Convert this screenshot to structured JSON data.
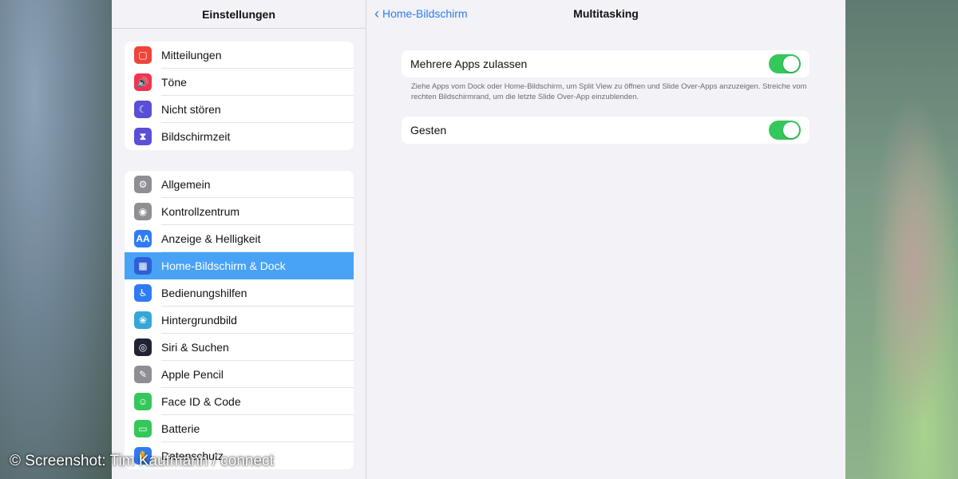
{
  "sidebar": {
    "title": "Einstellungen",
    "group1": [
      {
        "label": "Mitteilungen",
        "icon": "notifications-icon",
        "color": "#f0443a",
        "glyph": "▢"
      },
      {
        "label": "Töne",
        "icon": "sounds-icon",
        "color": "#f0344f",
        "glyph": "🔊"
      },
      {
        "label": "Nicht stören",
        "icon": "do-not-disturb-icon",
        "color": "#5a4fd6",
        "glyph": "☾"
      },
      {
        "label": "Bildschirmzeit",
        "icon": "screen-time-icon",
        "color": "#5a4fd6",
        "glyph": "⧗"
      }
    ],
    "group2": [
      {
        "label": "Allgemein",
        "icon": "general-icon",
        "color": "#8e8e93",
        "glyph": "⚙"
      },
      {
        "label": "Kontrollzentrum",
        "icon": "control-center-icon",
        "color": "#8e8e93",
        "glyph": "◉"
      },
      {
        "label": "Anzeige & Helligkeit",
        "icon": "display-icon",
        "color": "#2f7bf5",
        "glyph": "AA"
      },
      {
        "label": "Home-Bildschirm & Dock",
        "icon": "home-screen-icon",
        "color": "#2f5fd6",
        "glyph": "▦",
        "selected": true
      },
      {
        "label": "Bedienungshilfen",
        "icon": "accessibility-icon",
        "color": "#2f7bf5",
        "glyph": "♿"
      },
      {
        "label": "Hintergrundbild",
        "icon": "wallpaper-icon",
        "color": "#35a6d6",
        "glyph": "❀"
      },
      {
        "label": "Siri & Suchen",
        "icon": "siri-icon",
        "color": "#222236",
        "glyph": "◎"
      },
      {
        "label": "Apple Pencil",
        "icon": "pencil-icon",
        "color": "#8e8e93",
        "glyph": "✎"
      },
      {
        "label": "Face ID & Code",
        "icon": "face-id-icon",
        "color": "#34c759",
        "glyph": "☺"
      },
      {
        "label": "Batterie",
        "icon": "battery-icon",
        "color": "#34c759",
        "glyph": "▭"
      },
      {
        "label": "Datenschutz",
        "icon": "privacy-icon",
        "color": "#2f7bf5",
        "glyph": "✋"
      }
    ]
  },
  "detail": {
    "back_label": "Home-Bildschirm",
    "title": "Multitasking",
    "setting1": {
      "label": "Mehrere Apps zulassen",
      "on": true
    },
    "footnote": "Ziehe Apps vom Dock oder Home-Bildschirm, um Split View zu öffnen und Slide Over-Apps anzuzeigen. Streiche vom rechten Bildschirmrand, um die letzte Slide Over-App einzublenden.",
    "setting2": {
      "label": "Gesten",
      "on": true
    }
  },
  "watermark": "© Screenshot: Tim Kaufmann / connect",
  "colors": {
    "accent": "#2f7bf5",
    "selected": "#48a2f5",
    "toggle_on": "#34c759"
  }
}
